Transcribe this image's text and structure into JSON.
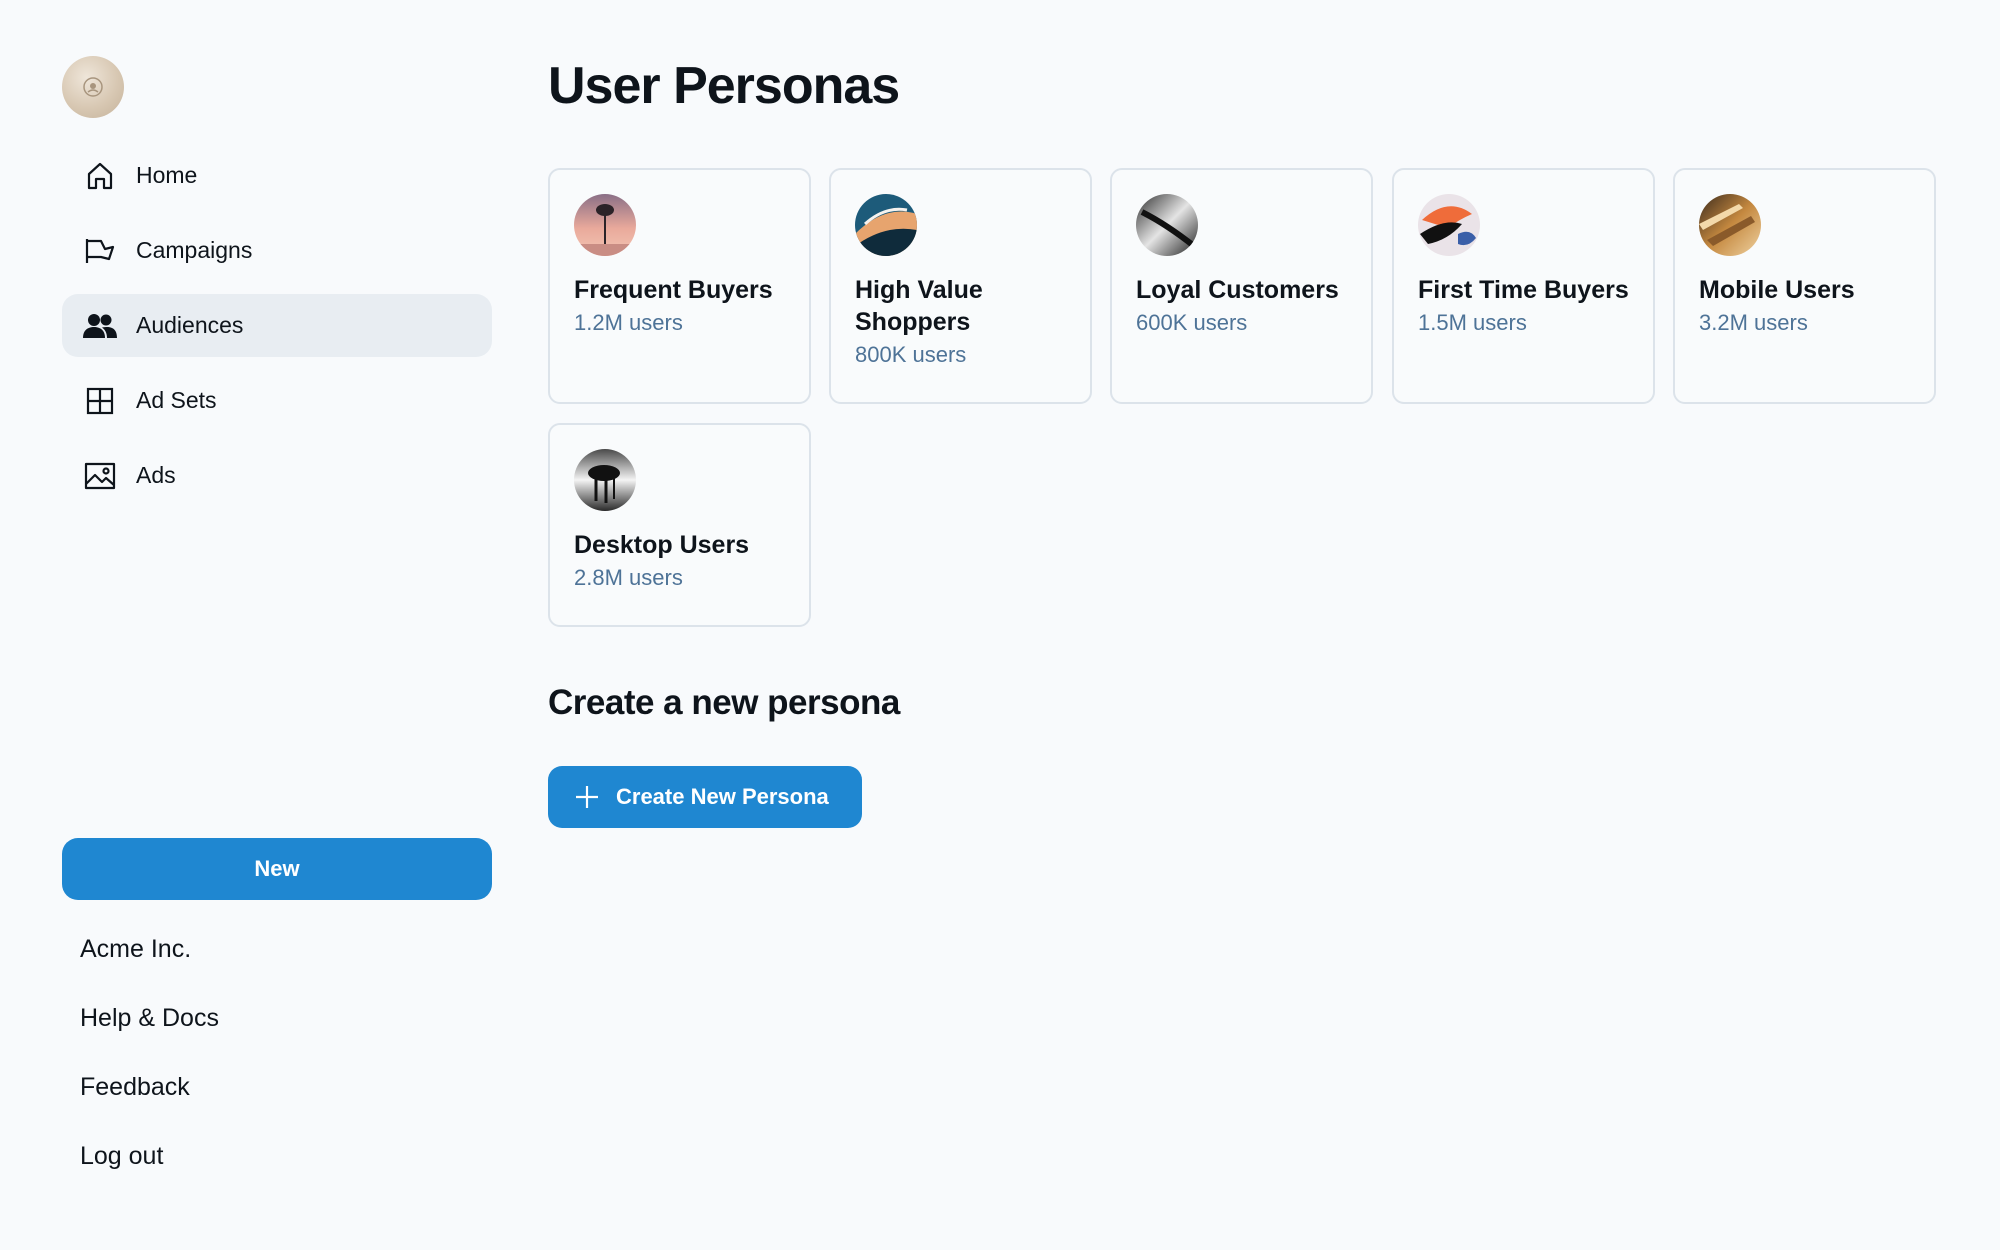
{
  "sidebar": {
    "nav": [
      {
        "label": "Home",
        "icon": "home-icon",
        "active": false
      },
      {
        "label": "Campaigns",
        "icon": "megaphone-icon",
        "active": false
      },
      {
        "label": "Audiences",
        "icon": "users-icon",
        "active": true
      },
      {
        "label": "Ad Sets",
        "icon": "grid-icon",
        "active": false
      },
      {
        "label": "Ads",
        "icon": "image-icon",
        "active": false
      }
    ],
    "new_button": "New",
    "footer": [
      "Acme Inc.",
      "Help & Docs",
      "Feedback",
      "Log out"
    ]
  },
  "main": {
    "title": "User Personas",
    "personas": [
      {
        "name": "Frequent Buyers",
        "count": "1.2M users"
      },
      {
        "name": "High Value Shoppers",
        "count": "800K users"
      },
      {
        "name": "Loyal Customers",
        "count": "600K users"
      },
      {
        "name": "First Time Buyers",
        "count": "1.5M users"
      },
      {
        "name": "Mobile Users",
        "count": "3.2M users"
      },
      {
        "name": "Desktop Users",
        "count": "2.8M users"
      }
    ],
    "create_section_title": "Create a new persona",
    "create_button": "Create New Persona"
  },
  "colors": {
    "accent": "#1f87d1",
    "background": "#f8fafc",
    "active_nav": "#e8edf2",
    "muted_text": "#4e7397"
  }
}
